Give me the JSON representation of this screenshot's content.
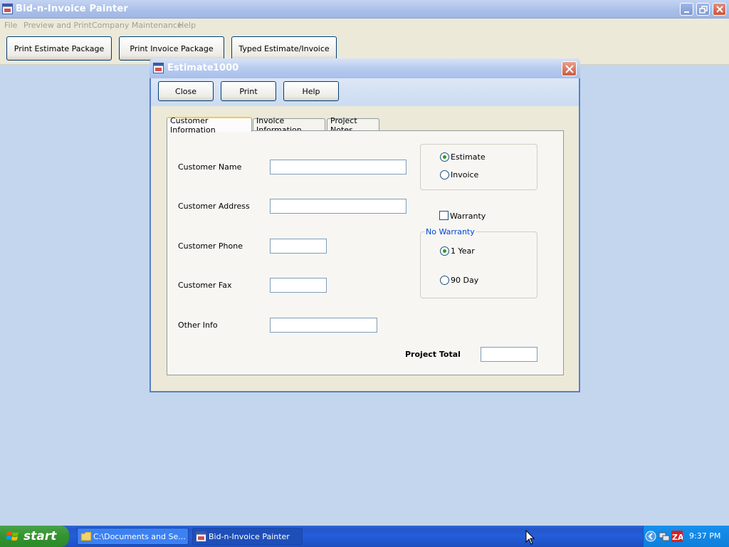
{
  "window": {
    "title": "Bid-n-Invoice Painter"
  },
  "menu": {
    "items": [
      "File",
      "Preview and Print",
      "Company Maintenance",
      "Help"
    ]
  },
  "toolbar": {
    "buttons": [
      "Print Estimate Package",
      "Print Invoice Package",
      "Typed Estimate/Invoice"
    ]
  },
  "dialog": {
    "title": "Estimate",
    "number": "1000",
    "buttons": {
      "close": "Close",
      "print": "Print",
      "help": "Help"
    },
    "tabs": [
      "Customer Information",
      "Invoice Information",
      "Project Notes"
    ],
    "active_tab": "Customer Information",
    "fields": {
      "customer_name": {
        "label": "Customer Name",
        "value": ""
      },
      "customer_address": {
        "label": "Customer Address",
        "value": ""
      },
      "customer_phone": {
        "label": "Customer Phone",
        "value": ""
      },
      "customer_fax": {
        "label": "Customer Fax",
        "value": ""
      },
      "other_info": {
        "label": "Other Info",
        "value": ""
      }
    },
    "doc_type": {
      "options": [
        "Estimate",
        "Invoice"
      ],
      "selected": "Estimate"
    },
    "warranty": {
      "checkbox_label": "Warranty",
      "checked": false,
      "group_caption": "No Warranty",
      "options": [
        "1 Year",
        "90 Day"
      ],
      "selected": "1 Year"
    },
    "project_total": {
      "label": "Project Total",
      "value": ""
    }
  },
  "taskbar": {
    "start_label": "start",
    "tasks": [
      "C:\\Documents and Se...",
      "Bid-n-Invoice Painter"
    ],
    "active_task": "Bid-n-Invoice Painter",
    "clock": "9:37 PM"
  },
  "icons": {
    "app": "app-window-icon",
    "folder": "folder-icon",
    "windows_logo": "windows-logo-icon"
  },
  "colors": {
    "desktop_bg": "#c3d6ee",
    "taskbar": "#245edb",
    "start_green": "#35922f",
    "radio_dot": "#21a121",
    "group_caption": "#0046d5"
  }
}
